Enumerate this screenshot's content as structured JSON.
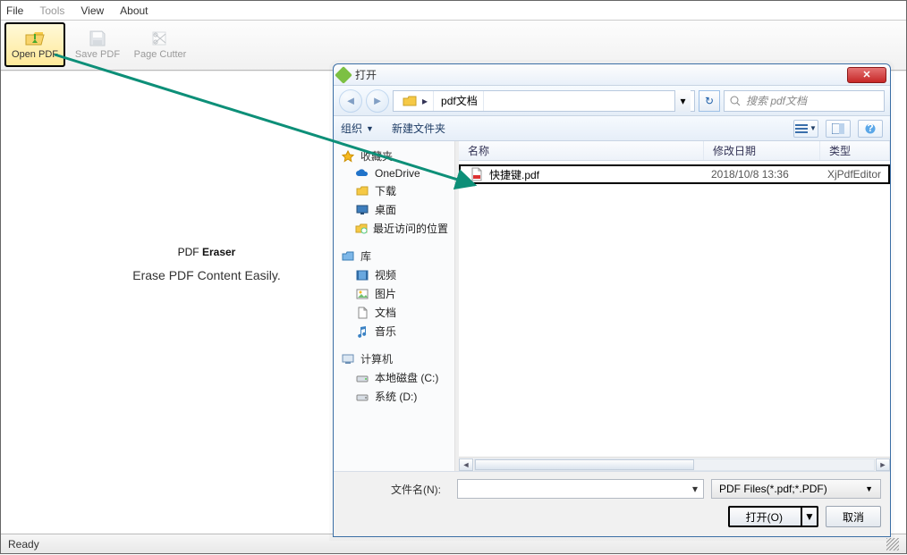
{
  "menu": {
    "file": "File",
    "tools": "Tools",
    "view": "View",
    "about": "About"
  },
  "toolbar": {
    "open": "Open PDF",
    "save": "Save PDF",
    "cutter": "Page Cutter"
  },
  "brand": {
    "name1": "PDF ",
    "name2": "Eraser",
    "sub": "Erase PDF Content Easily."
  },
  "status": {
    "ready": "Ready"
  },
  "dialog": {
    "title": "打开",
    "breadcrumb": {
      "folder": "pdf文档"
    },
    "search_placeholder": "搜索 pdf文档",
    "tb": {
      "organize": "组织",
      "newfolder": "新建文件夹"
    },
    "tree": {
      "fav": "收藏夹",
      "fav_items": {
        "onedrive": "OneDrive",
        "downloads": "下载",
        "desktop": "桌面",
        "recent": "最近访问的位置"
      },
      "lib": "库",
      "lib_items": {
        "video": "视频",
        "pictures": "图片",
        "docs": "文档",
        "music": "音乐"
      },
      "computer": "计算机",
      "drives": {
        "c": "本地磁盘 (C:)",
        "d": "系统 (D:)"
      }
    },
    "cols": {
      "name": "名称",
      "date": "修改日期",
      "type": "类型"
    },
    "rows": [
      {
        "name": "快捷键.pdf",
        "date": "2018/10/8 13:36",
        "type": "XjPdfEditor"
      }
    ],
    "footer": {
      "fname_label": "文件名(N):",
      "filter": "PDF Files(*.pdf;*.PDF)",
      "open": "打开(O)",
      "cancel": "取消"
    }
  }
}
